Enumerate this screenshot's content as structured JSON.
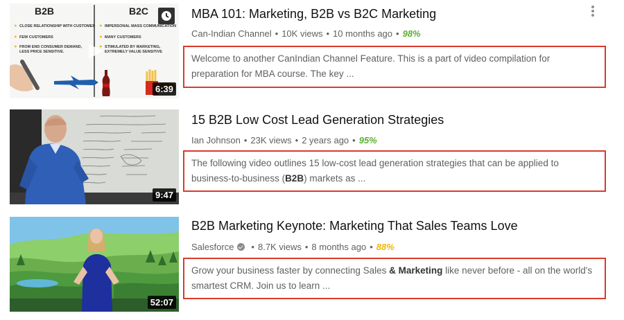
{
  "results": [
    {
      "title": "MBA 101: Marketing, B2B vs B2C Marketing",
      "channel": "Can-Indian Channel",
      "views": "10K views",
      "age": "10 months ago",
      "rating": "98%",
      "rating_color": "#5ab030",
      "duration": "6:39",
      "desc_parts": [
        "Welcome to another CanIndian Channel Feature. This is a part of video compilation for preparation for MBA course. The key ..."
      ],
      "thumb": {
        "left_heading": "B2B",
        "right_heading": "B2C",
        "left_bullets": [
          "CLOSE RELATIONSHIP WITH CUSTOMER",
          "FEW CUSTOMERS",
          "FROM END CONSUMER DEMAND, LESS PRICE SENSITIVE."
        ],
        "right_bullets": [
          "IMPERSONAL MASS COMMUNICATION",
          "MANY CUSTOMERS",
          "STIMULATED BY MARKETING, EXTREMELY VALUE SENSITIVE"
        ]
      }
    },
    {
      "title": "15 B2B Low Cost Lead Generation Strategies",
      "channel": "Ian Johnson",
      "views": "23K views",
      "age": "2 years ago",
      "rating": "95%",
      "rating_color": "#5ab030",
      "duration": "9:47",
      "desc_1": "The following video outlines 15 low-cost lead generation strategies that can be applied to business-to-business (",
      "desc_bold": "B2B",
      "desc_2": ") markets as ..."
    },
    {
      "title": "B2B Marketing Keynote: Marketing That Sales Teams Love",
      "channel": "Salesforce",
      "views": "8.7K views",
      "age": "8 months ago",
      "rating": "88%",
      "rating_color": "#f0b800",
      "duration": "52:07",
      "desc_1": "Grow your business faster by connecting Sales ",
      "desc_bold": "& Marketing",
      "desc_2": " like never before - all on the world's smartest CRM. Join us to learn ..."
    }
  ],
  "separator": "•"
}
